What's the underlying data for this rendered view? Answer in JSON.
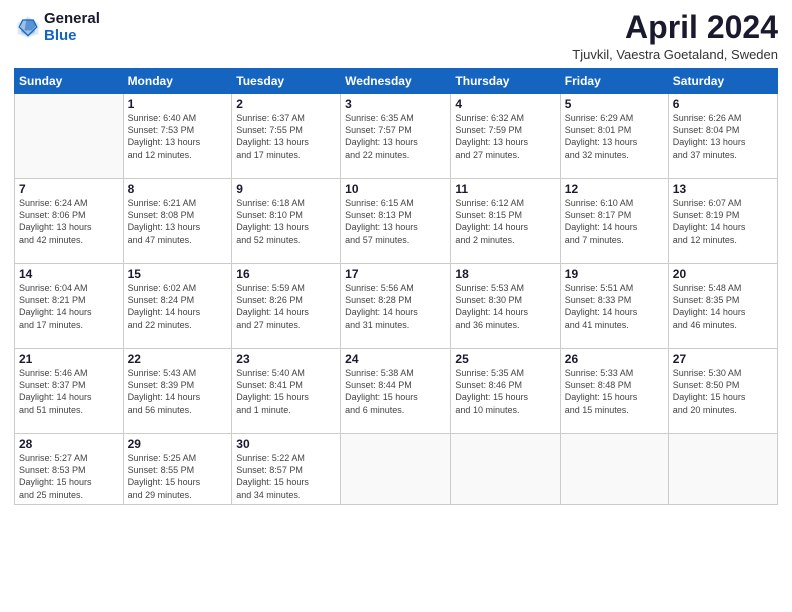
{
  "header": {
    "logo_line1": "General",
    "logo_line2": "Blue",
    "month_title": "April 2024",
    "subtitle": "Tjuvkil, Vaestra Goetaland, Sweden"
  },
  "weekdays": [
    "Sunday",
    "Monday",
    "Tuesday",
    "Wednesday",
    "Thursday",
    "Friday",
    "Saturday"
  ],
  "weeks": [
    [
      {
        "day": "",
        "info": ""
      },
      {
        "day": "1",
        "info": "Sunrise: 6:40 AM\nSunset: 7:53 PM\nDaylight: 13 hours\nand 12 minutes."
      },
      {
        "day": "2",
        "info": "Sunrise: 6:37 AM\nSunset: 7:55 PM\nDaylight: 13 hours\nand 17 minutes."
      },
      {
        "day": "3",
        "info": "Sunrise: 6:35 AM\nSunset: 7:57 PM\nDaylight: 13 hours\nand 22 minutes."
      },
      {
        "day": "4",
        "info": "Sunrise: 6:32 AM\nSunset: 7:59 PM\nDaylight: 13 hours\nand 27 minutes."
      },
      {
        "day": "5",
        "info": "Sunrise: 6:29 AM\nSunset: 8:01 PM\nDaylight: 13 hours\nand 32 minutes."
      },
      {
        "day": "6",
        "info": "Sunrise: 6:26 AM\nSunset: 8:04 PM\nDaylight: 13 hours\nand 37 minutes."
      }
    ],
    [
      {
        "day": "7",
        "info": "Sunrise: 6:24 AM\nSunset: 8:06 PM\nDaylight: 13 hours\nand 42 minutes."
      },
      {
        "day": "8",
        "info": "Sunrise: 6:21 AM\nSunset: 8:08 PM\nDaylight: 13 hours\nand 47 minutes."
      },
      {
        "day": "9",
        "info": "Sunrise: 6:18 AM\nSunset: 8:10 PM\nDaylight: 13 hours\nand 52 minutes."
      },
      {
        "day": "10",
        "info": "Sunrise: 6:15 AM\nSunset: 8:13 PM\nDaylight: 13 hours\nand 57 minutes."
      },
      {
        "day": "11",
        "info": "Sunrise: 6:12 AM\nSunset: 8:15 PM\nDaylight: 14 hours\nand 2 minutes."
      },
      {
        "day": "12",
        "info": "Sunrise: 6:10 AM\nSunset: 8:17 PM\nDaylight: 14 hours\nand 7 minutes."
      },
      {
        "day": "13",
        "info": "Sunrise: 6:07 AM\nSunset: 8:19 PM\nDaylight: 14 hours\nand 12 minutes."
      }
    ],
    [
      {
        "day": "14",
        "info": "Sunrise: 6:04 AM\nSunset: 8:21 PM\nDaylight: 14 hours\nand 17 minutes."
      },
      {
        "day": "15",
        "info": "Sunrise: 6:02 AM\nSunset: 8:24 PM\nDaylight: 14 hours\nand 22 minutes."
      },
      {
        "day": "16",
        "info": "Sunrise: 5:59 AM\nSunset: 8:26 PM\nDaylight: 14 hours\nand 27 minutes."
      },
      {
        "day": "17",
        "info": "Sunrise: 5:56 AM\nSunset: 8:28 PM\nDaylight: 14 hours\nand 31 minutes."
      },
      {
        "day": "18",
        "info": "Sunrise: 5:53 AM\nSunset: 8:30 PM\nDaylight: 14 hours\nand 36 minutes."
      },
      {
        "day": "19",
        "info": "Sunrise: 5:51 AM\nSunset: 8:33 PM\nDaylight: 14 hours\nand 41 minutes."
      },
      {
        "day": "20",
        "info": "Sunrise: 5:48 AM\nSunset: 8:35 PM\nDaylight: 14 hours\nand 46 minutes."
      }
    ],
    [
      {
        "day": "21",
        "info": "Sunrise: 5:46 AM\nSunset: 8:37 PM\nDaylight: 14 hours\nand 51 minutes."
      },
      {
        "day": "22",
        "info": "Sunrise: 5:43 AM\nSunset: 8:39 PM\nDaylight: 14 hours\nand 56 minutes."
      },
      {
        "day": "23",
        "info": "Sunrise: 5:40 AM\nSunset: 8:41 PM\nDaylight: 15 hours\nand 1 minute."
      },
      {
        "day": "24",
        "info": "Sunrise: 5:38 AM\nSunset: 8:44 PM\nDaylight: 15 hours\nand 6 minutes."
      },
      {
        "day": "25",
        "info": "Sunrise: 5:35 AM\nSunset: 8:46 PM\nDaylight: 15 hours\nand 10 minutes."
      },
      {
        "day": "26",
        "info": "Sunrise: 5:33 AM\nSunset: 8:48 PM\nDaylight: 15 hours\nand 15 minutes."
      },
      {
        "day": "27",
        "info": "Sunrise: 5:30 AM\nSunset: 8:50 PM\nDaylight: 15 hours\nand 20 minutes."
      }
    ],
    [
      {
        "day": "28",
        "info": "Sunrise: 5:27 AM\nSunset: 8:53 PM\nDaylight: 15 hours\nand 25 minutes."
      },
      {
        "day": "29",
        "info": "Sunrise: 5:25 AM\nSunset: 8:55 PM\nDaylight: 15 hours\nand 29 minutes."
      },
      {
        "day": "30",
        "info": "Sunrise: 5:22 AM\nSunset: 8:57 PM\nDaylight: 15 hours\nand 34 minutes."
      },
      {
        "day": "",
        "info": ""
      },
      {
        "day": "",
        "info": ""
      },
      {
        "day": "",
        "info": ""
      },
      {
        "day": "",
        "info": ""
      }
    ]
  ]
}
